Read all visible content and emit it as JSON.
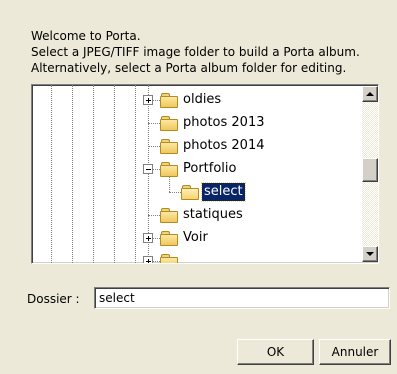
{
  "intro": {
    "line1": "Welcome to Porta.",
    "line2": "Select a JPEG/TIFF image folder to build a Porta album.",
    "line3": "Alternatively, select a Porta album folder for editing."
  },
  "tree": {
    "items": [
      {
        "label": "oldies",
        "expander": "plus",
        "icon": "folder-icon",
        "selected": false
      },
      {
        "label": "photos 2013",
        "expander": "none",
        "icon": "folder-icon",
        "selected": false
      },
      {
        "label": "photos 2014",
        "expander": "none",
        "icon": "folder-icon",
        "selected": false
      },
      {
        "label": "Portfolio",
        "expander": "minus",
        "icon": "folder-icon",
        "selected": false
      },
      {
        "label": "select",
        "expander": "none",
        "icon": "folder-open-icon",
        "selected": true
      },
      {
        "label": "statiques",
        "expander": "none",
        "icon": "folder-icon",
        "selected": false
      },
      {
        "label": "Voir",
        "expander": "plus",
        "icon": "folder-icon",
        "selected": false
      }
    ]
  },
  "dossier": {
    "label": "Dossier :",
    "value": "select"
  },
  "buttons": {
    "ok": "OK",
    "cancel": "Annuler"
  },
  "colors": {
    "dialog_bg": "#ece9d8",
    "selection_bg": "#0a246a",
    "selection_text": "#ffffff"
  }
}
